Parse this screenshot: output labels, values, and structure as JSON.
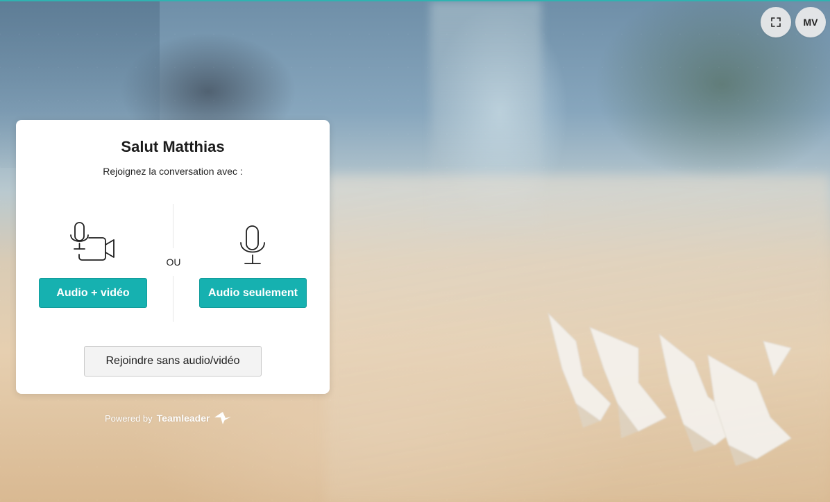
{
  "top_controls": {
    "fullscreen_icon": "fullscreen-icon",
    "avatar_initials": "MV"
  },
  "card": {
    "greeting": "Salut Matthias",
    "subtitle": "Rejoignez la conversation avec :",
    "separator": "OU",
    "audio_video_icon": "mic-camera-icon",
    "audio_only_icon": "microphone-icon",
    "audio_video_button": "Audio + vidéo",
    "audio_only_button": "Audio seulement",
    "no_av_button": "Rejoindre sans audio/vidéo"
  },
  "footer": {
    "powered_by": "Powered by",
    "brand": "Teamleader",
    "brand_icon": "teamleader-logo-icon"
  },
  "colors": {
    "accent": "#16b1b0",
    "top_border": "#2fb3b1"
  }
}
